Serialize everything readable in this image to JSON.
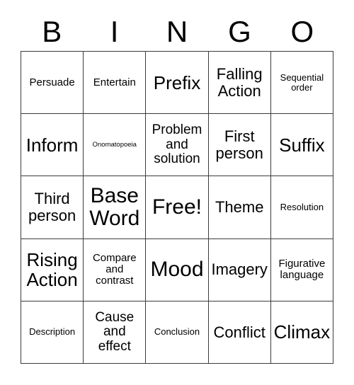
{
  "header": {
    "letters": [
      "B",
      "I",
      "N",
      "G",
      "O"
    ]
  },
  "grid": {
    "columns": 5,
    "rows": 5,
    "cells": [
      {
        "text": "Persuade",
        "size": "fs-sm"
      },
      {
        "text": "Entertain",
        "size": "fs-sm"
      },
      {
        "text": "Prefix",
        "size": "fs-xl"
      },
      {
        "text": "Falling Action",
        "size": "fs-lg"
      },
      {
        "text": "Sequential order",
        "size": "fs-xs"
      },
      {
        "text": "Inform",
        "size": "fs-xl"
      },
      {
        "text": "Onomatopoeia",
        "size": "fs-xxs"
      },
      {
        "text": "Problem and solution",
        "size": "fs-md"
      },
      {
        "text": "First person",
        "size": "fs-lg"
      },
      {
        "text": "Suffix",
        "size": "fs-xl"
      },
      {
        "text": "Third person",
        "size": "fs-lg"
      },
      {
        "text": "Base Word",
        "size": "fs-xxl"
      },
      {
        "text": "Free!",
        "size": "fs-xxl"
      },
      {
        "text": "Theme",
        "size": "fs-lg"
      },
      {
        "text": "Resolution",
        "size": "fs-xs"
      },
      {
        "text": "Rising Action",
        "size": "fs-xl"
      },
      {
        "text": "Compare and contrast",
        "size": "fs-sm"
      },
      {
        "text": "Mood",
        "size": "fs-xxl"
      },
      {
        "text": "Imagery",
        "size": "fs-lg"
      },
      {
        "text": "Figurative language",
        "size": "fs-sm"
      },
      {
        "text": "Description",
        "size": "fs-xs"
      },
      {
        "text": "Cause and effect",
        "size": "fs-md"
      },
      {
        "text": "Conclusion",
        "size": "fs-xs"
      },
      {
        "text": "Conflict",
        "size": "fs-lg"
      },
      {
        "text": "Climax",
        "size": "fs-xl"
      }
    ]
  },
  "colors": {
    "background": "#ffffff",
    "border": "#3b3b3b",
    "text": "#000000"
  }
}
